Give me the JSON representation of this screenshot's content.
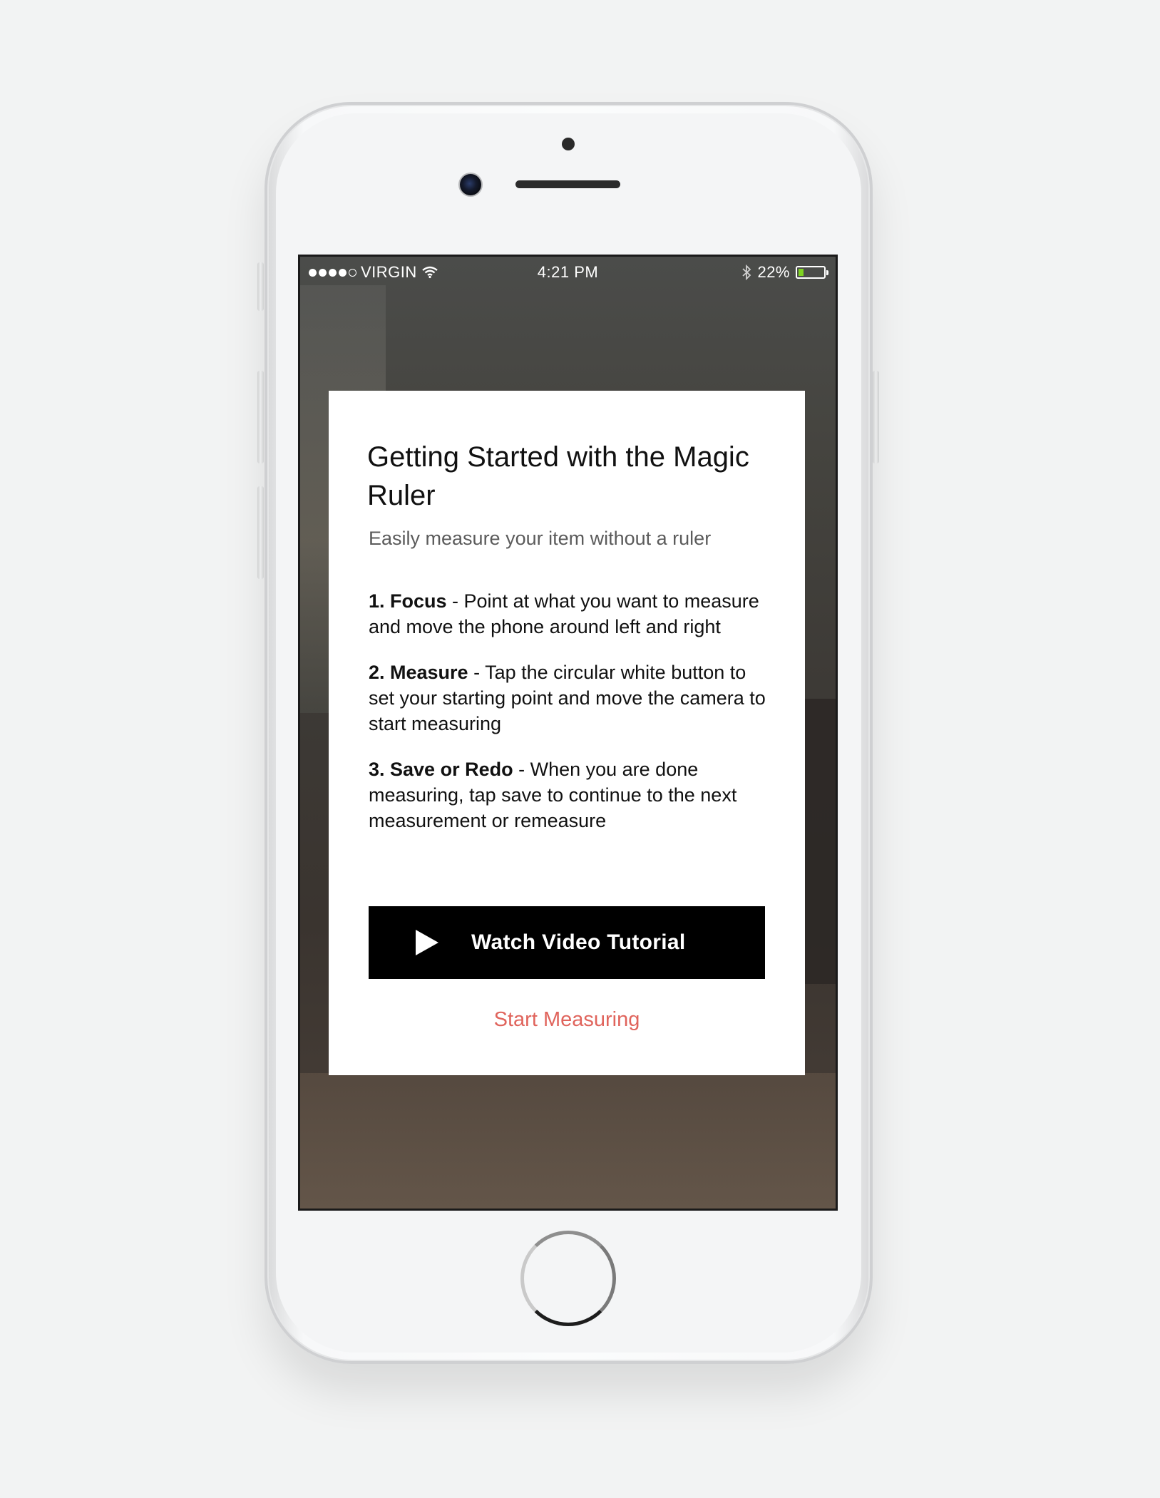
{
  "status_bar": {
    "carrier": "VIRGIN",
    "time": "4:21 PM",
    "battery_percent": "22%",
    "battery_level": 0.22,
    "battery_color": "#7ed321"
  },
  "modal": {
    "title": "Getting Started with the Magic Ruler",
    "subtitle": "Easily measure your item without a ruler",
    "steps": [
      {
        "label": "1. Focus",
        "text": " - Point at what you want to measure and move the phone around left and right"
      },
      {
        "label": "2. Measure",
        "text": " - Tap the circular white button to set your starting point and move the camera to start measuring"
      },
      {
        "label": "3. Save or Redo",
        "text": " - When you are done measuring, tap save to continue to the next measurement or remeasure"
      }
    ],
    "video_button_label": "Watch Video Tutorial",
    "start_link_label": "Start Measuring",
    "accent_color": "#e0645c"
  },
  "icons": {
    "play": "play-icon",
    "wifi": "wifi-icon",
    "bluetooth": "bluetooth-icon",
    "battery": "battery-icon",
    "signal": "signal-icon"
  }
}
